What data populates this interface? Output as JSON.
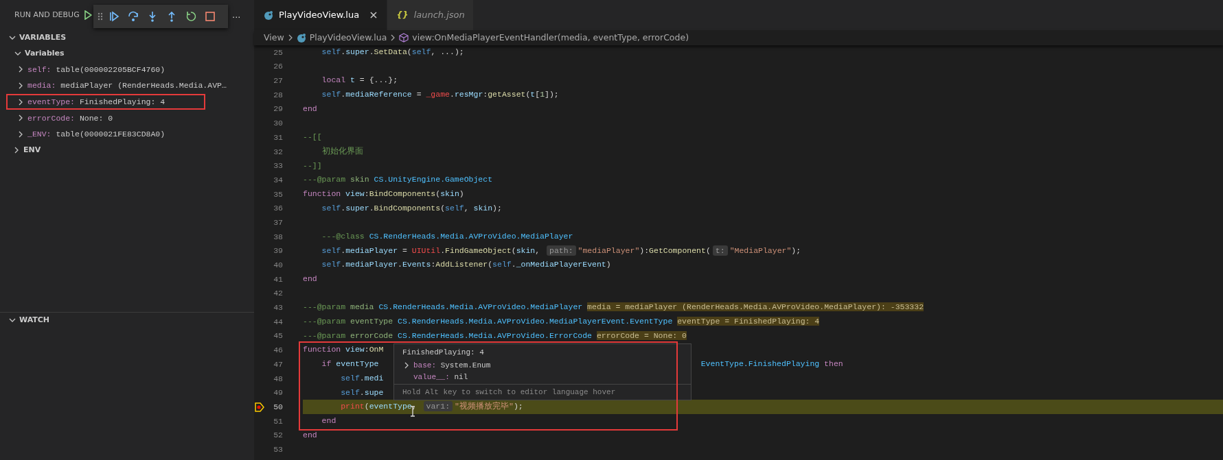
{
  "sidebar": {
    "title": "RUN AND DEBUG",
    "more": "...",
    "sections": [
      {
        "title": "VARIABLES",
        "expanded": true,
        "scopes": [
          {
            "title": "Variables",
            "expanded": true,
            "variables": [
              {
                "name": "self:",
                "value": "table(000002205BCF4760)",
                "expanded": false,
                "annotated": false
              },
              {
                "name": "media:",
                "value": "mediaPlayer (RenderHeads.Media.AVP…",
                "expanded": false,
                "annotated": false
              },
              {
                "name": "eventType:",
                "value": "FinishedPlaying: 4",
                "expanded": false,
                "annotated": true
              },
              {
                "name": "errorCode:",
                "value": "None: 0",
                "expanded": false,
                "annotated": false
              },
              {
                "name": "_ENV:",
                "value": "table(0000021FE83CD8A0)",
                "expanded": false,
                "annotated": false
              }
            ]
          },
          {
            "title": "ENV",
            "expanded": false
          }
        ]
      },
      {
        "title": "WATCH",
        "expanded": true
      }
    ]
  },
  "tabs": [
    {
      "label": "PlayVideoView.lua",
      "kind": "lua",
      "selected": true,
      "preview": false,
      "close": "×"
    },
    {
      "label": "launch.json",
      "kind": "json",
      "glyph": "{}",
      "selected": false,
      "preview": true
    }
  ],
  "breadcrumb": [
    {
      "label": "View",
      "kind": "folder"
    },
    {
      "label": "PlayVideoView.lua",
      "kind": "file"
    },
    {
      "label": "view:OnMediaPlayerEventHandler(media, eventType, errorCode)",
      "kind": "method"
    }
  ],
  "editor": {
    "annotation_box": true,
    "lines": [
      {
        "n": "25",
        "current": false,
        "tokens": [
          {
            "kind": "self",
            "text": "    self"
          },
          {
            "kind": "p",
            "text": "."
          },
          {
            "kind": "prop",
            "text": "super"
          },
          {
            "kind": "p",
            "text": "."
          },
          {
            "kind": "fn",
            "text": "SetData"
          },
          {
            "kind": "p",
            "text": "("
          },
          {
            "kind": "self",
            "text": "self"
          },
          {
            "kind": "p",
            "text": ", ...);"
          }
        ]
      },
      {
        "n": "26",
        "current": false
      },
      {
        "n": "27",
        "current": false,
        "tokens": [
          {
            "kind": "kw",
            "text": "    local"
          },
          {
            "kind": "prop",
            "text": " t"
          },
          {
            "kind": "p",
            "text": " = {...};"
          }
        ]
      },
      {
        "n": "28",
        "current": false,
        "tokens": [
          {
            "kind": "self",
            "text": "    self"
          },
          {
            "kind": "p",
            "text": "."
          },
          {
            "kind": "prop",
            "text": "mediaReference"
          },
          {
            "kind": "p",
            "text": " = "
          },
          {
            "kind": "err",
            "text": "_game"
          },
          {
            "kind": "p",
            "text": "."
          },
          {
            "kind": "prop",
            "text": "resMgr"
          },
          {
            "kind": "p",
            "text": ":"
          },
          {
            "kind": "fn",
            "text": "getAsset"
          },
          {
            "kind": "p",
            "text": "("
          },
          {
            "kind": "prop",
            "text": "t"
          },
          {
            "kind": "p",
            "text": "["
          },
          {
            "kind": "num",
            "text": "1"
          },
          {
            "kind": "p",
            "text": "]);"
          }
        ]
      },
      {
        "n": "29",
        "current": false,
        "tokens": [
          {
            "kind": "kw",
            "text": "end"
          }
        ]
      },
      {
        "n": "30",
        "current": false
      },
      {
        "n": "31",
        "current": false,
        "tokens": [
          {
            "kind": "cm",
            "text": "--[["
          }
        ]
      },
      {
        "n": "32",
        "current": false,
        "tokens": [
          {
            "kind": "cm",
            "text": "    初始化界面"
          }
        ]
      },
      {
        "n": "33",
        "current": false,
        "tokens": [
          {
            "kind": "cm",
            "text": "--]]"
          }
        ]
      },
      {
        "n": "34",
        "current": false,
        "tokens": [
          {
            "kind": "cm",
            "text": "---@param "
          },
          {
            "kind": "cmv",
            "text": "skin"
          },
          {
            "kind": "type",
            "text": " CS.UnityEngine.GameObject"
          }
        ]
      },
      {
        "n": "35",
        "current": false,
        "tokens": [
          {
            "kind": "kw",
            "text": "function"
          },
          {
            "kind": "prop",
            "text": " view"
          },
          {
            "kind": "p",
            "text": ":"
          },
          {
            "kind": "fn",
            "text": "BindComponents"
          },
          {
            "kind": "p",
            "text": "("
          },
          {
            "kind": "prm",
            "text": "skin"
          },
          {
            "kind": "p",
            "text": ")"
          }
        ]
      },
      {
        "n": "36",
        "current": false,
        "tokens": [
          {
            "kind": "self",
            "text": "    self"
          },
          {
            "kind": "p",
            "text": "."
          },
          {
            "kind": "prop",
            "text": "super"
          },
          {
            "kind": "p",
            "text": "."
          },
          {
            "kind": "fn",
            "text": "BindComponents"
          },
          {
            "kind": "p",
            "text": "("
          },
          {
            "kind": "self",
            "text": "self"
          },
          {
            "kind": "p",
            "text": ", "
          },
          {
            "kind": "prm",
            "text": "skin"
          },
          {
            "kind": "p",
            "text": ");"
          }
        ]
      },
      {
        "n": "37",
        "current": false
      },
      {
        "n": "38",
        "current": false,
        "tokens": [
          {
            "kind": "cm",
            "text": "    ---@class "
          },
          {
            "kind": "type",
            "text": "CS.RenderHeads.Media.AVProVideo.MediaPlayer"
          }
        ]
      },
      {
        "n": "39",
        "current": false,
        "tokens": [
          {
            "kind": "self",
            "text": "    self"
          },
          {
            "kind": "p",
            "text": "."
          },
          {
            "kind": "prop",
            "text": "mediaPlayer"
          },
          {
            "kind": "p",
            "text": " = "
          },
          {
            "kind": "err",
            "text": "UIUtil"
          },
          {
            "kind": "p",
            "text": "."
          },
          {
            "kind": "fn",
            "text": "FindGameObject"
          },
          {
            "kind": "p",
            "text": "("
          },
          {
            "kind": "prm",
            "text": "skin"
          },
          {
            "kind": "p",
            "text": ", "
          },
          {
            "kind": "hint",
            "text": "path:"
          },
          {
            "kind": "str",
            "text": "\"mediaPlayer\""
          },
          {
            "kind": "p",
            "text": ")"
          },
          {
            "kind": "p",
            "text": ":"
          },
          {
            "kind": "fn",
            "text": "GetComponent"
          },
          {
            "kind": "p",
            "text": "("
          },
          {
            "kind": "hint",
            "text": "t:"
          },
          {
            "kind": "str",
            "text": "\"MediaPlayer\""
          },
          {
            "kind": "p",
            "text": ");"
          }
        ]
      },
      {
        "n": "40",
        "current": false,
        "tokens": [
          {
            "kind": "self",
            "text": "    self"
          },
          {
            "kind": "p",
            "text": "."
          },
          {
            "kind": "prop",
            "text": "mediaPlayer"
          },
          {
            "kind": "p",
            "text": "."
          },
          {
            "kind": "prop",
            "text": "Events"
          },
          {
            "kind": "p",
            "text": ":"
          },
          {
            "kind": "fn",
            "text": "AddListener"
          },
          {
            "kind": "p",
            "text": "("
          },
          {
            "kind": "self",
            "text": "self"
          },
          {
            "kind": "p",
            "text": "."
          },
          {
            "kind": "prop",
            "text": "_onMediaPlayerEvent"
          },
          {
            "kind": "p",
            "text": ")"
          }
        ]
      },
      {
        "n": "41",
        "current": false,
        "tokens": [
          {
            "kind": "kw",
            "text": "end"
          }
        ]
      },
      {
        "n": "42",
        "current": false
      },
      {
        "n": "43",
        "current": false,
        "tokens": [
          {
            "kind": "cm",
            "text": "---@param "
          },
          {
            "kind": "cmv",
            "text": "media"
          },
          {
            "kind": "type",
            "text": " CS.RenderHeads.Media.AVProVideo.MediaPlayer "
          },
          {
            "kind": "val",
            "text": "media = mediaPlayer (RenderHeads.Media.AVProVideo.MediaPlayer): -353332"
          }
        ]
      },
      {
        "n": "44",
        "current": false,
        "tokens": [
          {
            "kind": "cm",
            "text": "---@param "
          },
          {
            "kind": "cmv",
            "text": "eventType"
          },
          {
            "kind": "type",
            "text": " CS.RenderHeads.Media.AVProVideo.MediaPlayerEvent.EventType "
          },
          {
            "kind": "val",
            "text": "eventType = FinishedPlaying: 4"
          }
        ]
      },
      {
        "n": "45",
        "current": false,
        "tokens": [
          {
            "kind": "cm",
            "text": "---@param "
          },
          {
            "kind": "cmv",
            "text": "errorCode"
          },
          {
            "kind": "type",
            "text": " CS.RenderHeads.Media.AVProVideo.ErrorCode "
          },
          {
            "kind": "val",
            "text": "errorCode = None: 0"
          }
        ]
      },
      {
        "n": "46",
        "current": false,
        "tokens": [
          {
            "kind": "kw",
            "text": "function"
          },
          {
            "kind": "prop",
            "text": " view"
          },
          {
            "kind": "p",
            "text": ":"
          },
          {
            "kind": "fn",
            "text": "OnM"
          }
        ]
      },
      {
        "n": "47",
        "current": false,
        "tokens": [
          {
            "kind": "kw",
            "text": "    if"
          },
          {
            "kind": "prm",
            "text": " eventType"
          }
        ],
        "after_hover": [
          {
            "kind": "type",
            "text": "EventType.FinishedPlaying"
          },
          {
            "kind": "kw",
            "text": " then"
          }
        ]
      },
      {
        "n": "48",
        "current": false,
        "tokens": [
          {
            "kind": "self",
            "text": "        self"
          },
          {
            "kind": "p",
            "text": "."
          },
          {
            "kind": "prop",
            "text": "medi"
          }
        ]
      },
      {
        "n": "49",
        "current": false,
        "tokens": [
          {
            "kind": "self",
            "text": "        self"
          },
          {
            "kind": "p",
            "text": "."
          },
          {
            "kind": "prop",
            "text": "supe"
          }
        ]
      },
      {
        "n": "50",
        "current": true,
        "tokens": [
          {
            "kind": "err",
            "text": "        print"
          },
          {
            "kind": "p",
            "text": "("
          },
          {
            "kind": "prm",
            "text": "eventType"
          },
          {
            "kind": "p",
            "text": ", "
          },
          {
            "kind": "hint",
            "text": "var1:"
          },
          {
            "kind": "str",
            "text": "\"视频播放完毕\""
          },
          {
            "kind": "p",
            "text": ");"
          }
        ]
      },
      {
        "n": "51",
        "current": false,
        "tokens": [
          {
            "kind": "kw",
            "text": "    end"
          }
        ]
      },
      {
        "n": "52",
        "current": false,
        "tokens": [
          {
            "kind": "kw",
            "text": "end"
          }
        ]
      },
      {
        "n": "53",
        "current": false
      }
    ]
  },
  "hover": {
    "title": "FinishedPlaying: 4",
    "rows": [
      {
        "name": "base:",
        "value": "System.Enum",
        "expandable": true
      },
      {
        "name": "value__:",
        "value": "nil",
        "expandable": false
      }
    ],
    "footer": "Hold Alt key to switch to editor language hover"
  }
}
